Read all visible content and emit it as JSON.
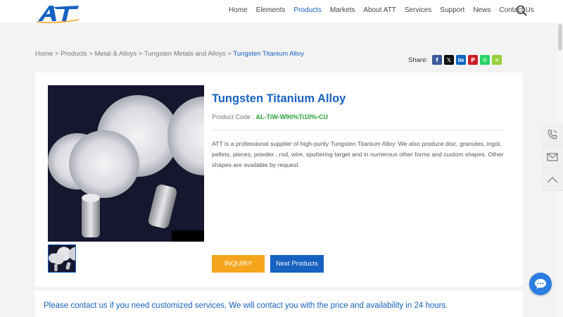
{
  "header": {
    "logo_text": "ATT",
    "nav": [
      "Home",
      "Elements",
      "Products",
      "Markets",
      "About ATT",
      "Services",
      "Support",
      "News",
      "Contact Us"
    ],
    "active_nav": "Products"
  },
  "breadcrumb": {
    "items": [
      "Home",
      "Products",
      "Metal & Alloys",
      "Tungsten Metals and Alloys"
    ],
    "separator": " > ",
    "current": "Tungsten Titanium Alloy"
  },
  "share": {
    "label": "Share:",
    "buttons": [
      {
        "name": "facebook",
        "glyph": "f",
        "color": "#3b5998"
      },
      {
        "name": "x",
        "glyph": "𝕏",
        "color": "#111111"
      },
      {
        "name": "linkedin",
        "glyph": "in",
        "color": "#0a66c2"
      },
      {
        "name": "pinterest",
        "glyph": "P",
        "color": "#cb2027"
      },
      {
        "name": "whatsapp",
        "glyph": "✆",
        "color": "#25d366"
      },
      {
        "name": "sharethis",
        "glyph": "<",
        "color": "#95d03a"
      }
    ]
  },
  "product": {
    "title": "Tungsten Titanium Alloy",
    "code_label": "Product Code : ",
    "code_value": "AL-TiW-W90%Ti10%-CU",
    "description": "ATT is a professional supplier of high-purity Tungsten Titanium Alloy. We also produce disc, granules, ingot, pellets, pieces, powder , rod, wire, sputtering target and in numerous other forms and custom shapes. Other shapes are available by request.",
    "inquiry_label": "INQUIRY",
    "next_label": "Next Products"
  },
  "notice": "Please contact us if you need customized services. We will contact you with the price and availability in 24 hours.",
  "side_tools": [
    "phone-icon",
    "mail-icon",
    "back-to-top-icon"
  ],
  "colors": {
    "brand_blue": "#1761c1",
    "inquiry_orange": "#f5a51c",
    "code_green": "#27a035",
    "chat_blue": "#2a7de1"
  }
}
